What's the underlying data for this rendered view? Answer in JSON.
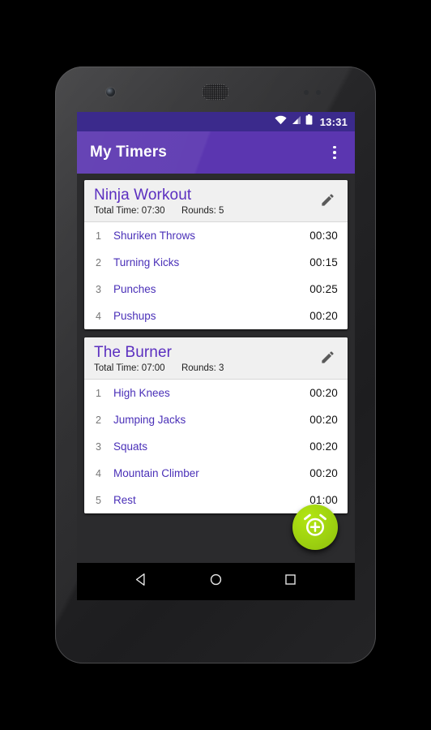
{
  "status_bar": {
    "time": "13:31",
    "icons": [
      "wifi-icon",
      "cellular-signal-icon",
      "battery-icon"
    ]
  },
  "app_bar": {
    "title": "My Timers",
    "overflow_label": "More options"
  },
  "colors": {
    "status_bar": "#3B2A8C",
    "app_bar": "#5B36B0",
    "card_title": "#5B2FC0",
    "row_name": "#4A30B8",
    "fab": "#9ED210",
    "background": "#2B2B2D"
  },
  "timers": [
    {
      "title": "Ninja Workout",
      "total_time_label": "Total Time: 07:30",
      "rounds_label": "Rounds: 5",
      "edit_icon": "pencil-icon",
      "exercises": [
        {
          "index": "1",
          "name": "Shuriken Throws",
          "duration": "00:30"
        },
        {
          "index": "2",
          "name": "Turning Kicks",
          "duration": "00:15"
        },
        {
          "index": "3",
          "name": "Punches",
          "duration": "00:25"
        },
        {
          "index": "4",
          "name": "Pushups",
          "duration": "00:20"
        }
      ]
    },
    {
      "title": "The Burner",
      "total_time_label": "Total Time: 07:00",
      "rounds_label": "Rounds: 3",
      "edit_icon": "pencil-icon",
      "exercises": [
        {
          "index": "1",
          "name": "High Knees",
          "duration": "00:20"
        },
        {
          "index": "2",
          "name": "Jumping Jacks",
          "duration": "00:20"
        },
        {
          "index": "3",
          "name": "Squats",
          "duration": "00:20"
        },
        {
          "index": "4",
          "name": "Mountain Climber",
          "duration": "00:20"
        },
        {
          "index": "5",
          "name": "Rest",
          "duration": "01:00"
        }
      ]
    }
  ],
  "fab": {
    "icon": "add-alarm-icon",
    "label": "Add timer"
  },
  "nav_bar": {
    "back": "back-icon",
    "home": "home-icon",
    "recents": "recents-icon"
  }
}
